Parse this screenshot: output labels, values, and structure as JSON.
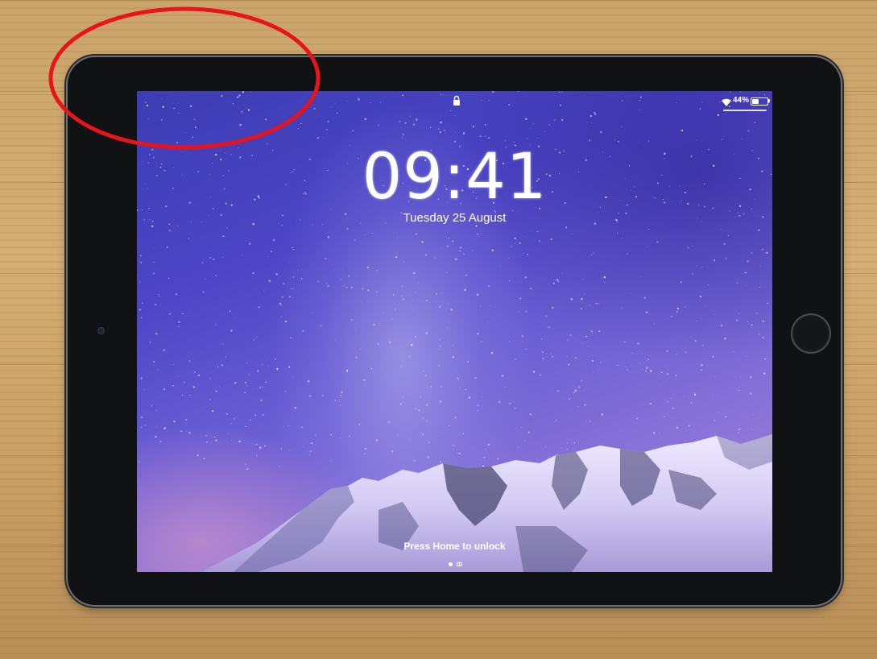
{
  "status_bar": {
    "battery_percent": "44%",
    "battery_level": 0.44,
    "icons": [
      "lock-icon",
      "wifi-icon",
      "battery-icon"
    ]
  },
  "lock_screen": {
    "time": "09:41",
    "date": "Tuesday 25 August",
    "unlock_hint": "Press Home to unlock",
    "page_indicator": [
      "page-dot",
      "camera-icon"
    ]
  },
  "annotation": {
    "shape": "ellipse",
    "color": "#e8141c"
  }
}
